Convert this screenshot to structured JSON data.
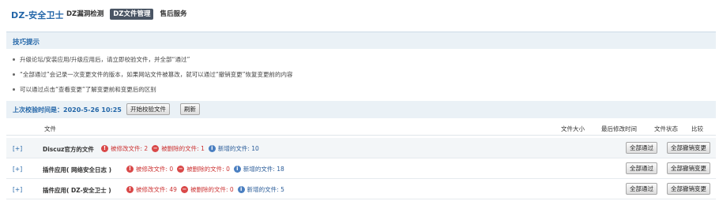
{
  "header": {
    "app_title": "DZ-安全卫士",
    "nav": [
      {
        "label": "DZ漏洞检测",
        "active": false
      },
      {
        "label": "DZ文件管理",
        "active": true
      },
      {
        "label": "售后服务",
        "active": false
      }
    ]
  },
  "tips": {
    "title": "技巧提示",
    "items": [
      "升级论坛/安装应用/升级应用后，请立即校验文件，并全部“通过”",
      "“全部通过”会记录一次变更文件的版本，如果网站文件被篡改，就可以通过“撤销变更”恢复变更前的内容",
      "可以通过点击“查看变更”了解变更前和变更后的区别"
    ]
  },
  "verify": {
    "last_time_label": "上次校验时间是：2020-5-26 10:25",
    "start_button": "开始校验文件",
    "refresh_button": "刷新"
  },
  "table": {
    "headers": {
      "file": "文件",
      "size": "文件大小",
      "modified": "最后修改时间",
      "status": "文件状态",
      "compare": "比较"
    },
    "rows": [
      {
        "expand": "[+]",
        "name": "Discuz官方的文件",
        "modified": "被修改文件: 2",
        "deleted": "被删除的文件: 1",
        "added": "新增的文件: 10",
        "pass_all": "全部通过",
        "revert_all": "全部撤销变更"
      },
      {
        "expand": "[+]",
        "name": "插件应用( 网络安全日志 )",
        "modified": "被修改文件: 0",
        "deleted": "被删除的文件: 0",
        "added": "新增的文件: 18",
        "pass_all": "全部通过",
        "revert_all": "全部撤销变更"
      },
      {
        "expand": "[+]",
        "name": "插件应用( DZ-安全卫士 )",
        "modified": "被修改文件: 49",
        "deleted": "被删除的文件: 0",
        "added": "新增的文件: 5",
        "pass_all": "全部通过",
        "revert_all": "全部撤销变更"
      }
    ]
  },
  "colors": {
    "accent": "#2366a8",
    "danger": "#d94848",
    "info": "#4a7fc1",
    "nav_active_bg": "#4a5564"
  }
}
